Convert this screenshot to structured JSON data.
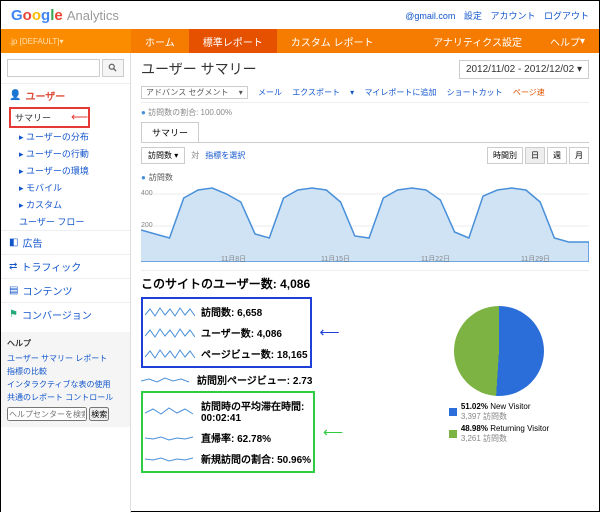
{
  "header": {
    "email_suffix": "@gmail.com",
    "links": [
      "設定",
      "アカウント",
      "ログアウト"
    ]
  },
  "account": {
    "label": ".jp [DEFAULT]"
  },
  "tabs": {
    "home": "ホーム",
    "report": "標準レポート",
    "custom": "カスタム レポート",
    "admin": "アナリティクス設定",
    "help": "ヘルプ"
  },
  "sidebar": {
    "users": "ユーザー",
    "items": [
      "サマリー",
      "ユーザーの分布",
      "ユーザーの行動",
      "ユーザーの環境",
      "モバイル",
      "カスタム",
      "ユーザー フロー"
    ],
    "ads": "広告",
    "traffic": "トラフィック",
    "content": "コンテンツ",
    "conv": "コンバージョン",
    "help": {
      "title": "ヘルプ",
      "links": [
        "ユーザー サマリー レポート",
        "指標の比較",
        "インタラクティブな表の使用",
        "共通のレポート コントロール"
      ],
      "placeholder": "ヘルプセンターを検索",
      "btn": "検索"
    }
  },
  "page": {
    "title": "ユーザー サマリー",
    "daterange": "2012/11/02 - 2012/12/02",
    "segment": "アドバンス セグメント",
    "toolbar": [
      "メール",
      "エクスポート",
      "マイレポートに追加",
      "ショートカット"
    ],
    "pagespeed": "ページ速",
    "ratio": "訪問数の割合: 100.00%",
    "tab": "サマリー",
    "metric": "訪問数",
    "vs": "対",
    "select": "指標を選択",
    "time": {
      "hour": "時間別",
      "day": "日",
      "week": "週",
      "month": "月"
    },
    "axis": {
      "y1": "400",
      "y2": "200",
      "x": [
        "11月8日",
        "11月15日",
        "11月22日",
        "11月29日"
      ]
    },
    "sitetotal": "このサイトのユーザー数: 4,086"
  },
  "metrics": {
    "visits": {
      "label": "訪問数:",
      "value": "6,658"
    },
    "users": {
      "label": "ユーザー数:",
      "value": "4,086"
    },
    "pageviews": {
      "label": "ページビュー数:",
      "value": "18,165"
    },
    "ppv": {
      "label": "訪問別ページビュー:",
      "value": "2.73"
    },
    "avgtime": {
      "label": "訪問時の平均滞在時間:",
      "value": "00:02:41"
    },
    "bounce": {
      "label": "直帰率:",
      "value": "62.78%"
    },
    "newvisit": {
      "label": "新規訪問の割合:",
      "value": "50.96%"
    }
  },
  "pie": {
    "new": {
      "pct": "51.02%",
      "label": "New Visitor",
      "sub": "3,397 訪問数"
    },
    "ret": {
      "pct": "48.98%",
      "label": "Returning Visitor",
      "sub": "3,261 訪問数"
    }
  },
  "chart_data": {
    "type": "line",
    "x": [
      "11/02",
      "11/03",
      "11/04",
      "11/05",
      "11/06",
      "11/07",
      "11/08",
      "11/09",
      "11/10",
      "11/11",
      "11/12",
      "11/13",
      "11/14",
      "11/15",
      "11/16",
      "11/17",
      "11/18",
      "11/19",
      "11/20",
      "11/21",
      "11/22",
      "11/23",
      "11/24",
      "11/25",
      "11/26",
      "11/27",
      "11/28",
      "11/29",
      "11/30",
      "12/01",
      "12/02"
    ],
    "values": [
      160,
      140,
      120,
      320,
      360,
      370,
      340,
      300,
      140,
      120,
      320,
      360,
      370,
      360,
      300,
      130,
      120,
      320,
      360,
      370,
      360,
      310,
      150,
      120,
      330,
      360,
      370,
      360,
      300,
      120,
      100
    ],
    "title": "訪問数",
    "ylabel": "",
    "ylim": [
      0,
      450
    ]
  }
}
